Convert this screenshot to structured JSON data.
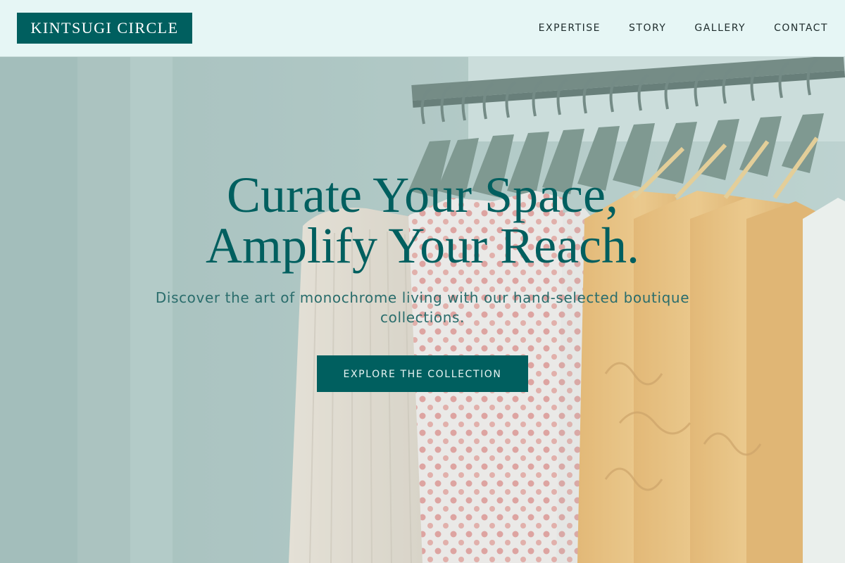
{
  "header": {
    "logo_text": "KINTSUGI CIRCLE",
    "nav": [
      {
        "label": "EXPERTISE"
      },
      {
        "label": "STORY"
      },
      {
        "label": "GALLERY"
      },
      {
        "label": "CONTACT"
      }
    ]
  },
  "hero": {
    "title_line1": "Curate Your Space,",
    "title_line2": "Amplify Your Reach.",
    "subtitle": "Discover the art of monochrome living with our hand-selected boutique collections.",
    "cta_label": "EXPLORE THE COLLECTION",
    "background_image": "clothing-rack-photo"
  },
  "colors": {
    "brand_teal": "#005f5f",
    "header_bg": "#e6f6f5",
    "subtitle_teal": "#2a6d6c",
    "nav_text": "#1d2b2b"
  }
}
